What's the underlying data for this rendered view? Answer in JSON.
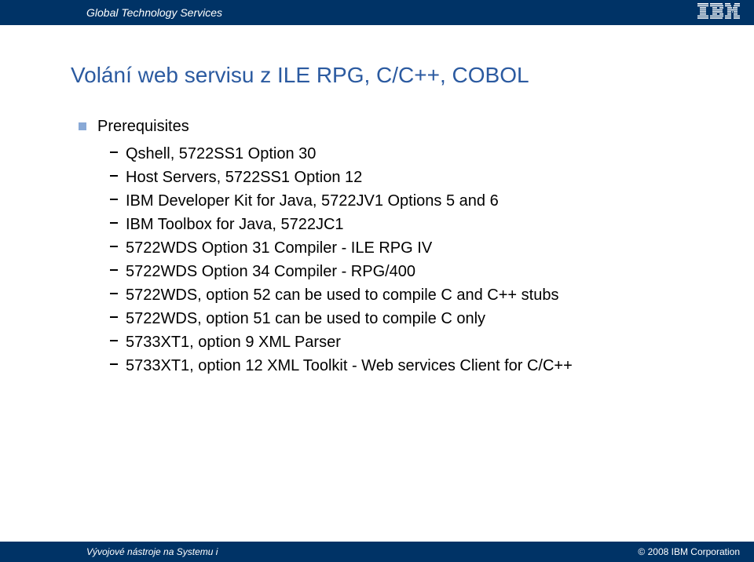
{
  "header": {
    "title": "Global Technology Services"
  },
  "slide": {
    "title": "Volání web servisu z ILE RPG, C/C++, COBOL",
    "section_heading": "Prerequisites",
    "items": [
      "Qshell, 5722SS1 Option 30",
      "Host Servers, 5722SS1 Option 12",
      "IBM Developer Kit for Java, 5722JV1 Options 5 and 6",
      "IBM Toolbox for Java, 5722JC1",
      "5722WDS Option 31 Compiler - ILE RPG IV",
      "5722WDS Option 34 Compiler - RPG/400",
      "5722WDS, option 52 can be used to compile C and C++ stubs",
      "5722WDS, option 51 can be used to compile C only",
      "5733XT1, option 9 XML Parser",
      "5733XT1, option 12 XML Toolkit - Web services Client for C/C++"
    ]
  },
  "footer": {
    "left": "Vývojové nástroje na Systemu i",
    "right": "© 2008 IBM Corporation"
  }
}
